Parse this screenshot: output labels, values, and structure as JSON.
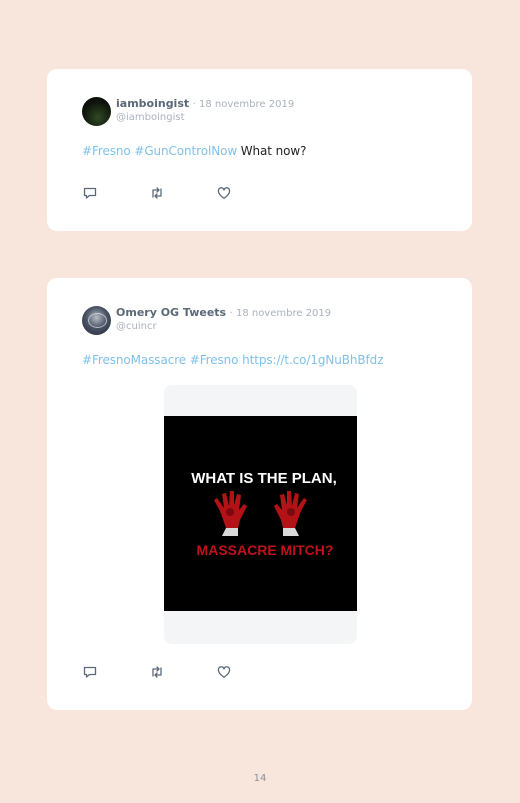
{
  "tweets": [
    {
      "author": "iamboingist",
      "date": "· 18 novembre 2019",
      "handle": "@iamboingist",
      "text_links": [
        "#Fresno",
        "#GunControlNow"
      ],
      "text_plain": " What now?"
    },
    {
      "author": "Omery OG Tweets",
      "date": "· 18 novembre 2019",
      "handle": "@cuincr",
      "text_links": [
        "#FresnoMassacre",
        "#Fresno",
        "https://t.co/1gNuBhBfdz"
      ],
      "media": {
        "line1": "WHAT IS THE PLAN,",
        "line2": "MASSACRE MITCH?"
      }
    }
  ],
  "icons": [
    "reply-icon",
    "retweet-icon",
    "like-icon"
  ],
  "page_number": "14",
  "colors": {
    "background": "#f8e6dc",
    "card": "#ffffff",
    "link": "#7fc1ea",
    "name": "#5b6878",
    "muted": "#aab2bd",
    "blood": "#c0121a"
  }
}
